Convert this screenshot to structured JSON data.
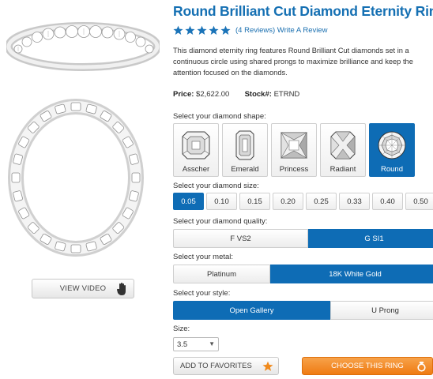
{
  "product": {
    "title": "Round Brilliant Cut Diamond Eternity Ring",
    "rating_stars": 5,
    "reviews_link": "(4 Reviews) Write A Review",
    "description": "This diamond eternity ring features Round Brilliant Cut diamonds set in a continuous circle using shared prongs to maximize brilliance and keep the attention focused on the diamonds.",
    "price_label": "Price:",
    "price_value": "$2,622.00",
    "stock_label": "Stock#:",
    "stock_value": "ETRND"
  },
  "video_button": {
    "label": "VIEW VIDEO",
    "icon": "hand-icon"
  },
  "shape_section": {
    "label": "Select your diamond shape:",
    "options": [
      "Asscher",
      "Emerald",
      "Princess",
      "Radiant",
      "Round"
    ],
    "selected": "Round"
  },
  "size_section": {
    "label": "Select your diamond size:",
    "options": [
      "0.05",
      "0.10",
      "0.15",
      "0.20",
      "0.25",
      "0.33",
      "0.40",
      "0.50"
    ],
    "selected": "0.05"
  },
  "quality_section": {
    "label": "Select your diamond quality:",
    "options": [
      "F VS2",
      "G SI1"
    ],
    "selected": "G SI1"
  },
  "metal_section": {
    "label": "Select your metal:",
    "options": [
      "Platinum",
      "18K White Gold"
    ],
    "selected": "18K White Gold"
  },
  "style_section": {
    "label": "Select your style:",
    "options": [
      "Open Gallery",
      "U Prong"
    ],
    "selected": "Open Gallery"
  },
  "ring_size": {
    "label": "Size:",
    "value": "3.5"
  },
  "actions": {
    "favorites_label": "ADD TO FAVORITES",
    "choose_label": "CHOOSE THIS RING"
  },
  "colors": {
    "title_blue": "#1570b3",
    "selected_blue": "#0e6cb5",
    "star_blue": "#1a73b8",
    "cta_orange": "#ef7b12"
  }
}
